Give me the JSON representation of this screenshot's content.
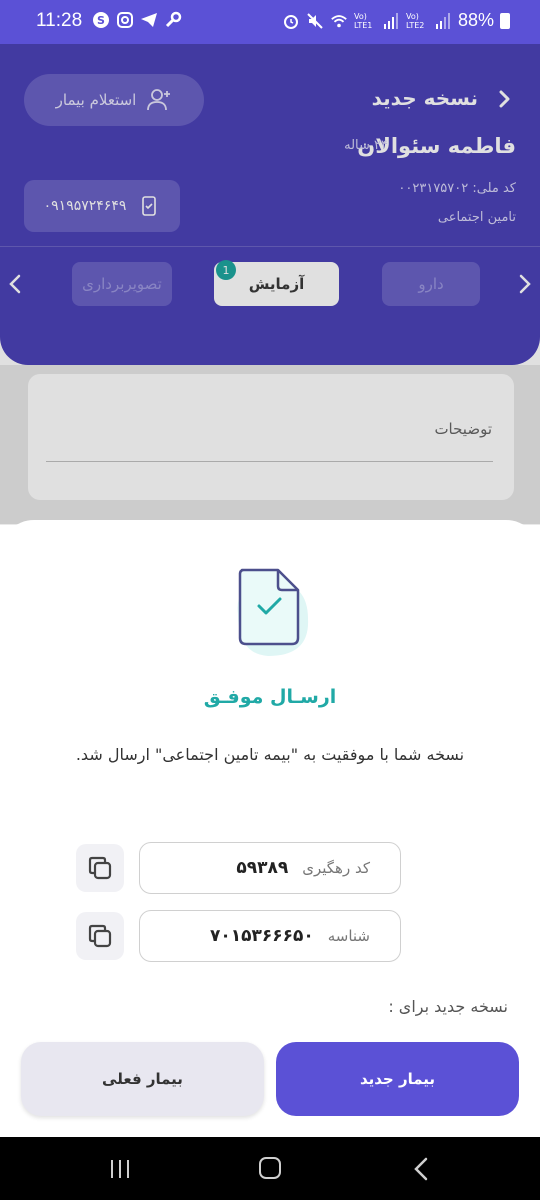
{
  "status_bar": {
    "time": "11:28",
    "battery": "88%",
    "sim1": "Vo) LTE1",
    "sim2": "Vo) LTE2",
    "left_icons": [
      "skype-icon",
      "instagram-icon",
      "telegram-icon",
      "wrench-icon"
    ],
    "right_icons": [
      "alarm-icon",
      "mute-icon",
      "wifi-icon",
      "signal-icon",
      "battery-icon"
    ]
  },
  "header": {
    "title": "نسخه جدید",
    "inquiry_button": "استعلام بیمار",
    "patient_name": "فاطمه سئوالان",
    "age": "۲۴ ساله",
    "national_id": "کد ملی: ۰۰۲۳۱۷۵۷۰۲",
    "insurance": "تامین اجتماعی",
    "phone": "۰۹۱۹۵۷۲۴۶۴۹"
  },
  "tabs": [
    {
      "label": "دارو",
      "state": "inactive"
    },
    {
      "label": "آزمایش",
      "state": "active",
      "badge": "1"
    },
    {
      "label": "تصویربرداری",
      "state": "inactive"
    }
  ],
  "form": {
    "description_label": "توضیحات"
  },
  "sheet": {
    "title": "ارسـال موفـق",
    "message": "نسخه شما با موفقیت به \"بیمه تامین اجتماعی\" ارسال شد.",
    "tracking_label": "کد رهگیری",
    "tracking_value": "۵۹۳۸۹",
    "id_label": "شناسه",
    "id_value": "۷۰۱۵۳۶۶۶۵۰",
    "new_for_label": "نسخه جدید برای :",
    "new_patient_button": "بیمار جدید",
    "current_patient_button": "بیمار فعلی"
  },
  "colors": {
    "header_purple": "#4c43b8",
    "status_purple": "#5b51d6",
    "accent_teal": "#20a9a6",
    "primary_button": "#5b51d6"
  }
}
